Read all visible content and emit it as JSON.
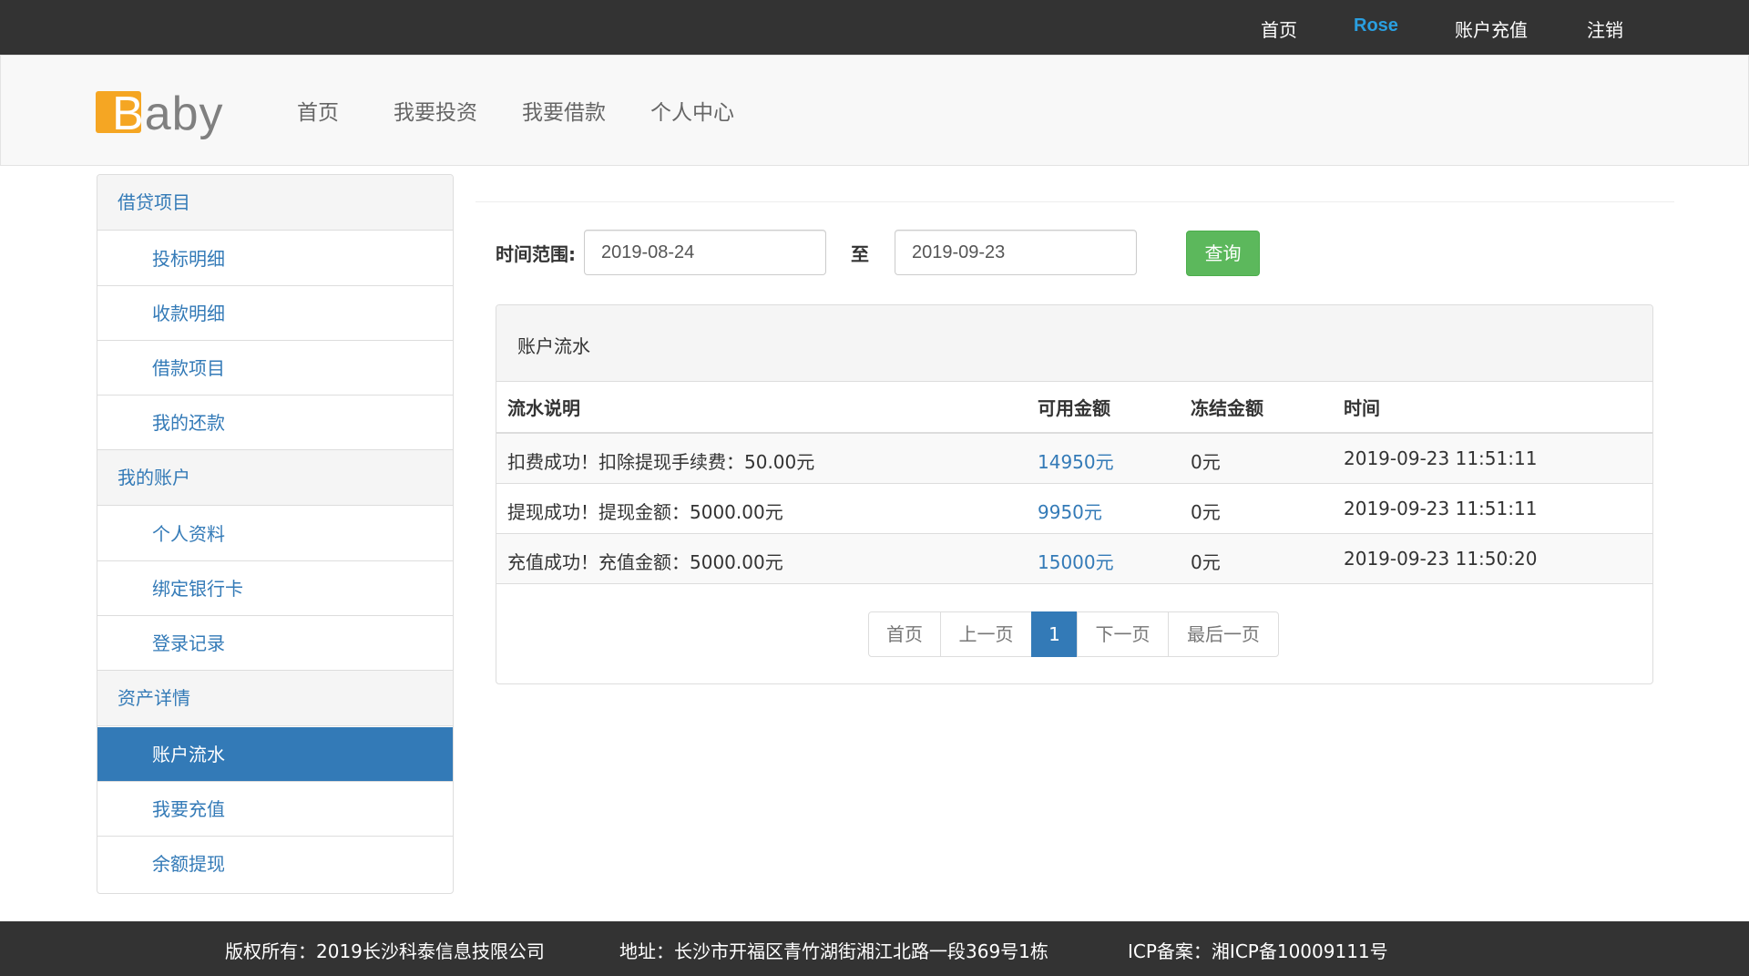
{
  "topbar": {
    "home": "首页",
    "user": "Rose",
    "recharge": "账户充值",
    "logout": "注销"
  },
  "logo": {
    "first_letter": "B",
    "rest": "aby"
  },
  "mainnav": [
    "首页",
    "我要投资",
    "我要借款",
    "个人中心"
  ],
  "sidebar": {
    "groups": [
      {
        "title": "借贷项目",
        "items": [
          "投标明细",
          "收款明细",
          "借款项目",
          "我的还款"
        ]
      },
      {
        "title": "我的账户",
        "items": [
          "个人资料",
          "绑定银行卡",
          "登录记录"
        ]
      },
      {
        "title": "资产详情",
        "items": [
          "账户流水",
          "我要充值",
          "余额提现"
        ]
      }
    ],
    "active_item": "账户流水"
  },
  "filter": {
    "label": "时间范围:",
    "start_date": "2019-08-24",
    "to": "至",
    "end_date": "2019-09-23",
    "query_button": "查询"
  },
  "panel": {
    "title": "账户流水",
    "columns": [
      "流水说明",
      "可用金额",
      "冻结金额",
      "时间"
    ],
    "rows": [
      [
        "扣费成功！扣除提现手续费：50.00元",
        "14950元",
        "0元",
        "2019-09-23 11:51:11"
      ],
      [
        "提现成功！提现金额：5000.00元",
        "9950元",
        "0元",
        "2019-09-23 11:51:11"
      ],
      [
        "充值成功！充值金额：5000.00元",
        "15000元",
        "0元",
        "2019-09-23 11:50:20"
      ]
    ]
  },
  "pagination": {
    "first": "首页",
    "prev": "上一页",
    "current": "1",
    "next": "下一页",
    "last": "最后一页"
  },
  "footer": {
    "copyright": "版权所有：2019长沙科泰信息技限公司",
    "address": "地址：长沙市开福区青竹湖街湘江北路一段369号1栋",
    "icp": "ICP备案：湘ICP备10009111号"
  },
  "colors": {
    "topbar_bg": "#333333",
    "accent_blue": "#337ab7",
    "user_blue": "#2a9fe0",
    "logo_orange": "#f5a623",
    "query_green": "#5cb85c"
  }
}
